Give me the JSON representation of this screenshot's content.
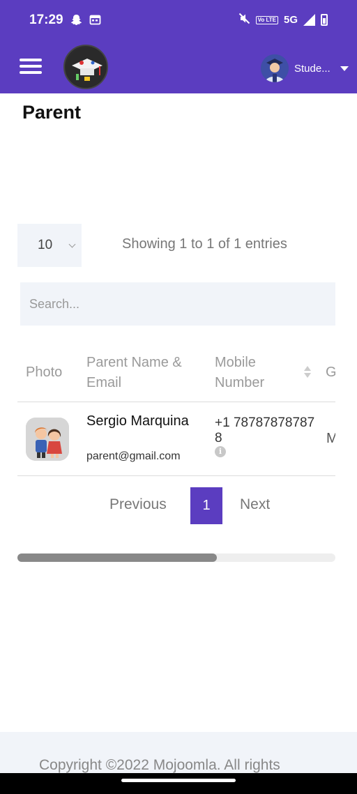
{
  "status_bar": {
    "time": "17:29",
    "network": "5G",
    "volte_label": "Vo LTE",
    "icons": [
      "snapchat-icon",
      "calendar-icon",
      "mute-icon",
      "volte-icon",
      "signal-icon",
      "battery-icon"
    ]
  },
  "header": {
    "user_name": "Stude..."
  },
  "page": {
    "title": "Parent"
  },
  "table_controls": {
    "page_length": "10",
    "info": "Showing 1 to 1 of 1 entries",
    "search_placeholder": "Search..."
  },
  "table": {
    "columns": {
      "photo": "Photo",
      "name_email": "Parent Name & Email",
      "mobile": "Mobile Number",
      "gender": "G"
    },
    "rows": [
      {
        "name": "Sergio Marquina",
        "email": "parent@gmail.com",
        "mobile": "+1 787878787878",
        "gender": "M"
      }
    ]
  },
  "pagination": {
    "previous": "Previous",
    "current": "1",
    "next": "Next"
  },
  "footer": {
    "copyright": "Copyright ©2022 Mojoomla. All rights"
  },
  "colors": {
    "primary": "#5b3dc0",
    "input_bg": "#f1f4f9",
    "muted_text": "#9a9a9a"
  }
}
